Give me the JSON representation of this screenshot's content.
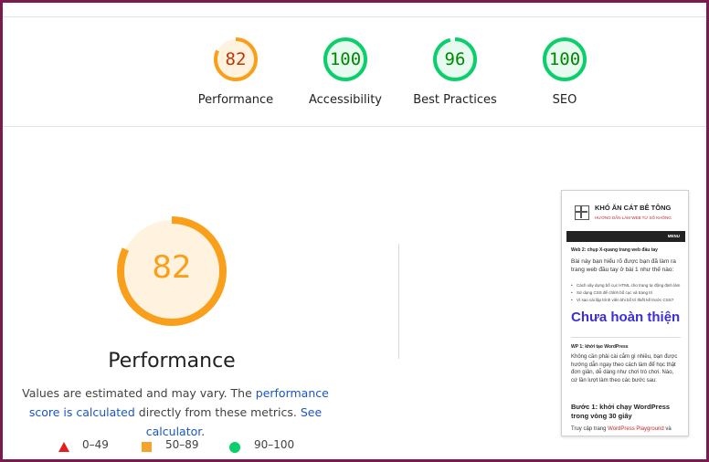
{
  "colors": {
    "page_border": "#7a1a4d",
    "average_orange": "#fa9f1b",
    "average_text": "#c33300",
    "pass_green": "#0cce6b",
    "pass_text": "#008800",
    "fail_red": "#e02020",
    "link_blue": "#1a56c4"
  },
  "summary": [
    {
      "key": "performance",
      "score": "82",
      "value": 82,
      "label": "Performance",
      "rating": "average"
    },
    {
      "key": "accessibility",
      "score": "100",
      "value": 100,
      "label": "Accessibility",
      "rating": "pass"
    },
    {
      "key": "best_practices",
      "score": "96",
      "value": 96,
      "label": "Best Practices",
      "rating": "pass"
    },
    {
      "key": "seo",
      "score": "100",
      "value": 100,
      "label": "SEO",
      "rating": "pass"
    }
  ],
  "main": {
    "score": "82",
    "value": 82,
    "title": "Performance",
    "note_prefix": "Values are estimated and may vary. The ",
    "note_link": "performance score is calculated",
    "note_middle": " directly from these metrics. ",
    "note_calc": "See calculator",
    "note_suffix": "."
  },
  "legend": [
    {
      "icon": "red-triangle-icon",
      "label": "0–49"
    },
    {
      "icon": "orange-square-icon",
      "label": "50–89"
    },
    {
      "icon": "green-circle-icon",
      "label": "90–100"
    }
  ],
  "thumbnail": {
    "site_title": "KHÓ ĂN CÁT BÊ TÔNG",
    "tagline": "HƯỚNG DẪN LÀM WEB TỪ SỐ KHÔNG",
    "menu": "MENU",
    "heading1": "Web 2: chụp X-quang trang web đầu tay",
    "para1": "Bài này bạn hiểu rõ được bạn đã làm ra trang web đầu tay ở bài 1 như thế nào:",
    "list": [
      "Cách xây dựng bố cục HTML cho trang tự động định làm",
      "Sử dụng CSS để chỉnh bố cục và trang trí",
      "Vì sao cái lập trình viên khi bố trí thiết kế trước CSS?"
    ],
    "big_text": "Chưa hoàn thiện",
    "heading2": "WP 1: khởi tạo WordPress",
    "para2": "Không cần phải cài cắm gì nhiều, bạn được hướng dẫn ngay theo cách làm để học thật đơn giản, dễ dàng như chơi trò chơi. Nào, cứ lần lượt làm theo các bước sau:",
    "heading3": "Bước 1: khởi chạy WordPress trong vòng 30 giây",
    "para3_prefix": "Truy cập trang ",
    "para3_link": "WordPress Playground",
    "para3_suffix": " và"
  }
}
